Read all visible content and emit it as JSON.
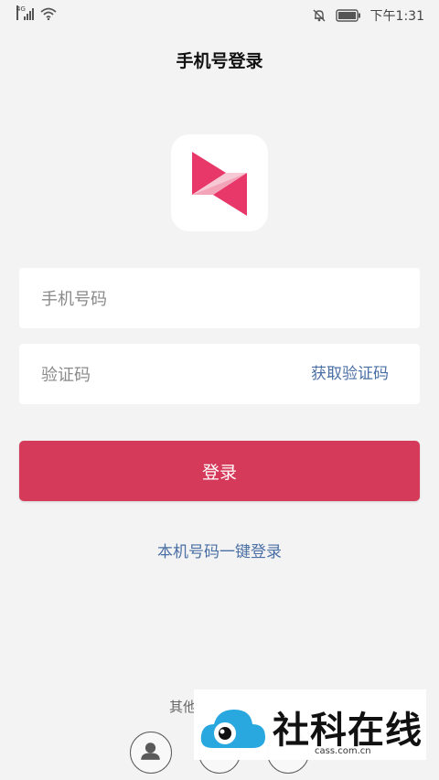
{
  "status_bar": {
    "network": "4G",
    "time": "下午1:31"
  },
  "header": {
    "title": "手机号登录"
  },
  "form": {
    "phone_placeholder": "手机号码",
    "code_placeholder": "验证码",
    "get_code_label": "获取验证码",
    "login_label": "登录"
  },
  "one_click_login": "本机号码一键登录",
  "other_login": {
    "label": "其他"
  },
  "watermark": {
    "text": "社科在线",
    "url": "cass.com.cn"
  },
  "colors": {
    "accent": "#d63a5a",
    "link": "#4a6fa5",
    "background": "#f3f3f3"
  },
  "icons": {
    "app_logo": "app-logo",
    "signal": "signal-icon",
    "wifi": "wifi-icon",
    "mute": "mute-bell-icon",
    "battery": "battery-icon",
    "user": "user-icon",
    "cloud": "cloud-eye-icon"
  }
}
